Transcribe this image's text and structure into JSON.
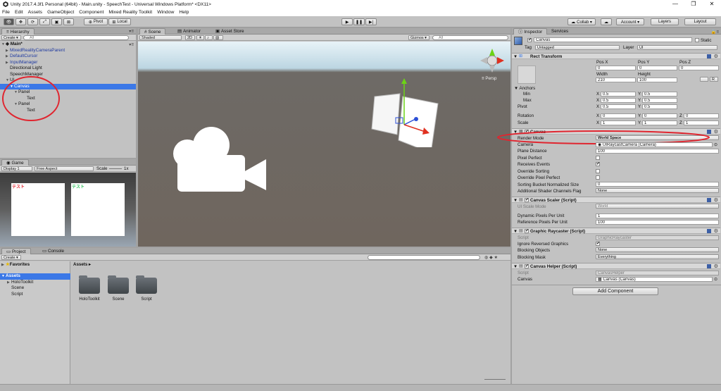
{
  "window": {
    "title": "Unity 2017.4.3f1 Personal (64bit) - Main.unity - SpeechTest - Universal Windows Platform* <DX11>",
    "minimize": "—",
    "maximize": "❐",
    "close": "✕"
  },
  "menu": [
    "File",
    "Edit",
    "Assets",
    "GameObject",
    "Component",
    "Mixed Reality Toolkit",
    "Window",
    "Help"
  ],
  "toolbar": {
    "pivot": "Pivot",
    "local": "Local",
    "collab": "Collab ▾",
    "account": "Account ▾",
    "layers": "Layers",
    "layout": "Layout"
  },
  "hierarchy": {
    "tab": "Hierarchy",
    "create": "Create ▾",
    "search_placeholder": "All",
    "scene": "Main*",
    "items": [
      {
        "label": "MixedRealityCameraParent"
      },
      {
        "label": "DefaultCursor"
      },
      {
        "label": "InputManager"
      },
      {
        "label": "Directional Light"
      },
      {
        "label": "SpeechManager"
      },
      {
        "label": "UI"
      },
      {
        "label": "Canvas"
      },
      {
        "label": "Panel"
      },
      {
        "label": "Text"
      },
      {
        "label": "Panel"
      },
      {
        "label": "Text"
      }
    ]
  },
  "scene_view": {
    "tabs": [
      "Scene",
      "Animator",
      "Asset Store"
    ],
    "shaded": "Shaded",
    "mode_2d": "2D",
    "gizmos": "Gizmos ▾",
    "search_placeholder": "All",
    "persp": "≡ Persp"
  },
  "game_view": {
    "tab": "Game",
    "display": "Display 1",
    "aspect": "Free Aspect",
    "scale_label": "Scale",
    "scale_value": "1x",
    "text1": "テスト",
    "text2": "テスト"
  },
  "project": {
    "tabs": [
      "Project",
      "Console"
    ],
    "create": "Create ▾",
    "favorites": "Favorites",
    "assets": "Assets",
    "tree": [
      "HoloToolkit",
      "Scene",
      "Script"
    ],
    "breadcrumb": "Assets ▸",
    "folders": [
      "HoloToolkit",
      "Scene",
      "Script"
    ]
  },
  "inspector": {
    "tabs": [
      "Inspector",
      "Services"
    ],
    "name": "Canvas",
    "static": "Static",
    "tag_label": "Tag",
    "tag": "Untagged",
    "layer_label": "Layer",
    "layer": "UI",
    "rect": {
      "title": "Rect Transform",
      "posx_label": "Pos X",
      "posy_label": "Pos Y",
      "posz_label": "Pos Z",
      "posx": "0",
      "posy": "0",
      "posz": "0",
      "width_label": "Width",
      "height_label": "Height",
      "width": "210",
      "height": "100",
      "r_btn": "R",
      "anchors": "Anchors",
      "min": "Min",
      "max": "Max",
      "pivot": "Pivot",
      "min_x": "0.5",
      "min_y": "0.5",
      "max_x": "0.5",
      "max_y": "0.5",
      "pivot_x": "0.5",
      "pivot_y": "0.5",
      "rotation": "Rotation",
      "rot_x": "0",
      "rot_y": "0",
      "rot_z": "0",
      "scale": "Scale",
      "scale_x": "1",
      "scale_y": "1",
      "scale_z": "1",
      "x": "X",
      "y": "Y",
      "z": "Z"
    },
    "canvas": {
      "title": "Canvas",
      "render_mode_label": "Render Mode",
      "render_mode": "World Space",
      "camera_label": "Camera",
      "camera": "UIRaycastCamera (Camera)",
      "plane_label": "Plane Distance",
      "plane": "100",
      "pixel_perfect": "Pixel Perfect",
      "receives_events": "Receives Events",
      "override_sorting": "Override Sorting",
      "override_pixel_perfect": "Override Pixel Perfect",
      "sorting_bucket_label": "Sorting Bucket Normalized Size",
      "sorting_bucket": "0",
      "shader_channels_label": "Additional Shader Channels Flag",
      "shader_channels": "None"
    },
    "scaler": {
      "title": "Canvas Scaler (Script)",
      "ui_scale_label": "UI Scale Mode",
      "ui_scale": "World",
      "dyn_label": "Dynamic Pixels Per Unit",
      "dyn": "1",
      "ref_label": "Reference Pixels Per Unit",
      "ref": "100"
    },
    "raycaster": {
      "title": "Graphic Raycaster (Script)",
      "script_label": "Script",
      "script": "GraphicRaycaster",
      "ignore_label": "Ignore Reversed Graphics",
      "blocking_objects_label": "Blocking Objects",
      "blocking_objects": "None",
      "blocking_mask_label": "Blocking Mask",
      "blocking_mask": "Everything"
    },
    "helper": {
      "title": "Canvas Helper (Script)",
      "script_label": "Script",
      "script": "CanvasHelper",
      "canvas_label": "Canvas",
      "canvas": "Canvas (Canvas)"
    },
    "add_component": "Add Component"
  },
  "colors": {
    "accent": "#3b78e7",
    "annotation": "#e0252f",
    "panel": "#c2c2c2"
  }
}
